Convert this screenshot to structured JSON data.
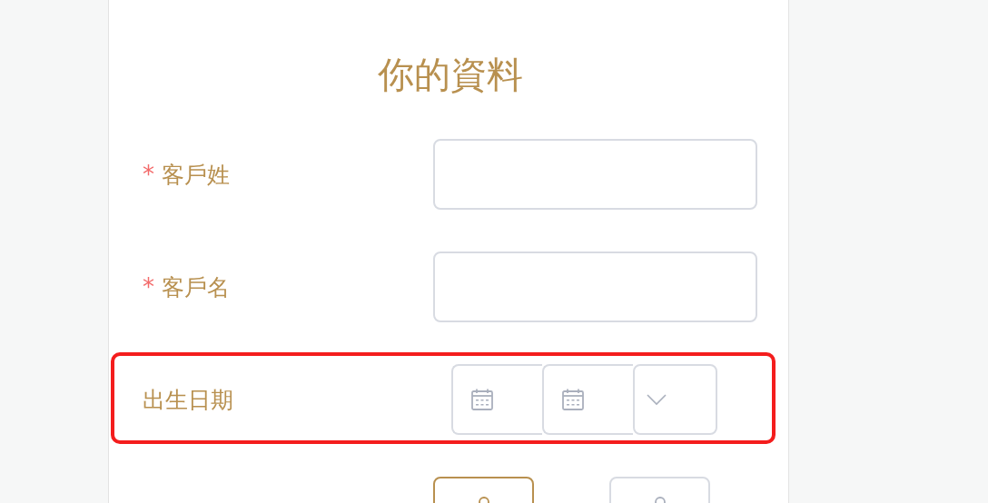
{
  "form": {
    "title": "你的資料",
    "fields": [
      {
        "kind": "text",
        "label": "客戶姓",
        "required_mark": "*",
        "highlighted": false
      },
      {
        "kind": "text",
        "label": "客戶名",
        "required_mark": "*",
        "highlighted": false
      },
      {
        "kind": "date",
        "label": "出生日期",
        "highlighted": true
      },
      {
        "kind": "choice",
        "highlighted": false,
        "options": [
          {
            "selected": true
          },
          {
            "selected": false
          }
        ]
      }
    ]
  }
}
